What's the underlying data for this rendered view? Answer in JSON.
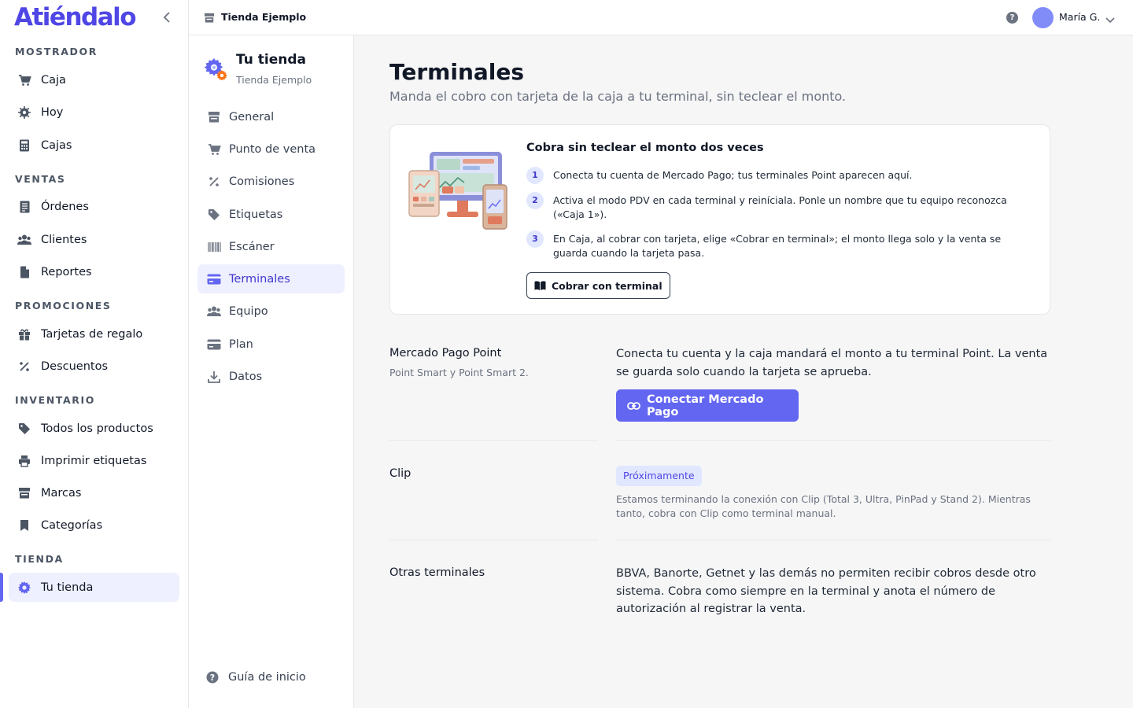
{
  "brand": {
    "name": "Atiéndalo"
  },
  "topbar": {
    "store_name": "Tienda Ejemplo",
    "user_name": "María G."
  },
  "sidebar": {
    "sections": [
      {
        "title": "MOSTRADOR",
        "items": [
          {
            "label": "Caja",
            "icon": "cart-icon"
          },
          {
            "label": "Hoy",
            "icon": "sun-icon"
          },
          {
            "label": "Cajas",
            "icon": "calculator-icon"
          }
        ]
      },
      {
        "title": "VENTAS",
        "items": [
          {
            "label": "Órdenes",
            "icon": "receipt-icon"
          },
          {
            "label": "Clientes",
            "icon": "users-icon"
          },
          {
            "label": "Reportes",
            "icon": "document-icon"
          }
        ]
      },
      {
        "title": "PROMOCIONES",
        "items": [
          {
            "label": "Tarjetas de regalo",
            "icon": "gift-icon"
          },
          {
            "label": "Descuentos",
            "icon": "percent-icon"
          }
        ]
      },
      {
        "title": "INVENTARIO",
        "items": [
          {
            "label": "Todos los productos",
            "icon": "tag-icon"
          },
          {
            "label": "Imprimir etiquetas",
            "icon": "printer-icon"
          },
          {
            "label": "Marcas",
            "icon": "store-icon"
          },
          {
            "label": "Categorías",
            "icon": "bookmark-icon"
          }
        ]
      },
      {
        "title": "TIENDA",
        "items": [
          {
            "label": "Tu tienda",
            "icon": "gear-icon",
            "active": true
          }
        ]
      }
    ]
  },
  "settings_nav": {
    "title": "Tu tienda",
    "subtitle": "Tienda Ejemplo",
    "items": [
      {
        "label": "General",
        "icon": "store-icon"
      },
      {
        "label": "Punto de venta",
        "icon": "cart-icon"
      },
      {
        "label": "Comisiones",
        "icon": "percent-icon"
      },
      {
        "label": "Etiquetas",
        "icon": "tag-icon"
      },
      {
        "label": "Escáner",
        "icon": "barcode-icon"
      },
      {
        "label": "Terminales",
        "icon": "credit-card-icon",
        "active": true
      },
      {
        "label": "Equipo",
        "icon": "users-icon"
      },
      {
        "label": "Plan",
        "icon": "credit-card-icon"
      },
      {
        "label": "Datos",
        "icon": "download-icon"
      }
    ],
    "guide_label": "Guía de inicio"
  },
  "main": {
    "title": "Terminales",
    "subtitle": "Manda el cobro con tarjeta de la caja a tu terminal, sin teclear el monto.",
    "card": {
      "title": "Cobra sin teclear el monto dos veces",
      "steps": [
        {
          "num": "1",
          "text": "Conecta tu cuenta de Mercado Pago; tus terminales Point aparecen aquí."
        },
        {
          "num": "2",
          "text": "Activa el modo PDV en cada terminal y reiníciala. Ponle un nombre que tu equipo reconozca («Caja 1»)."
        },
        {
          "num": "3",
          "text": "En Caja, al cobrar con tarjeta, elige «Cobrar en terminal»; el monto llega solo y la venta se guarda cuando la tarjeta pasa."
        }
      ],
      "button_label": "Cobrar con terminal"
    },
    "mercado_pago": {
      "label": "Mercado Pago Point",
      "sub": "Point Smart y Point Smart 2.",
      "text": "Conecta tu cuenta y la caja mandará el monto a tu terminal Point. La venta se guarda solo cuando la tarjeta se aprueba.",
      "button_label": "Conectar Mercado Pago"
    },
    "clip": {
      "label": "Clip",
      "badge": "Próximamente",
      "text": "Estamos terminando la conexión con Clip (Total 3, Ultra, PinPad y Stand 2). Mientras tanto, cobra con Clip como terminal manual."
    },
    "otras": {
      "label": "Otras terminales",
      "text": "BBVA, Banorte, Getnet y las demás no permiten recibir cobros desde otro sistema. Cobra como siempre en la terminal y anota el número de autorización al registrar la venta."
    }
  },
  "colors": {
    "accent": "#6366f1",
    "brand": "#4f46e5",
    "active_bg": "#eef0ff"
  }
}
